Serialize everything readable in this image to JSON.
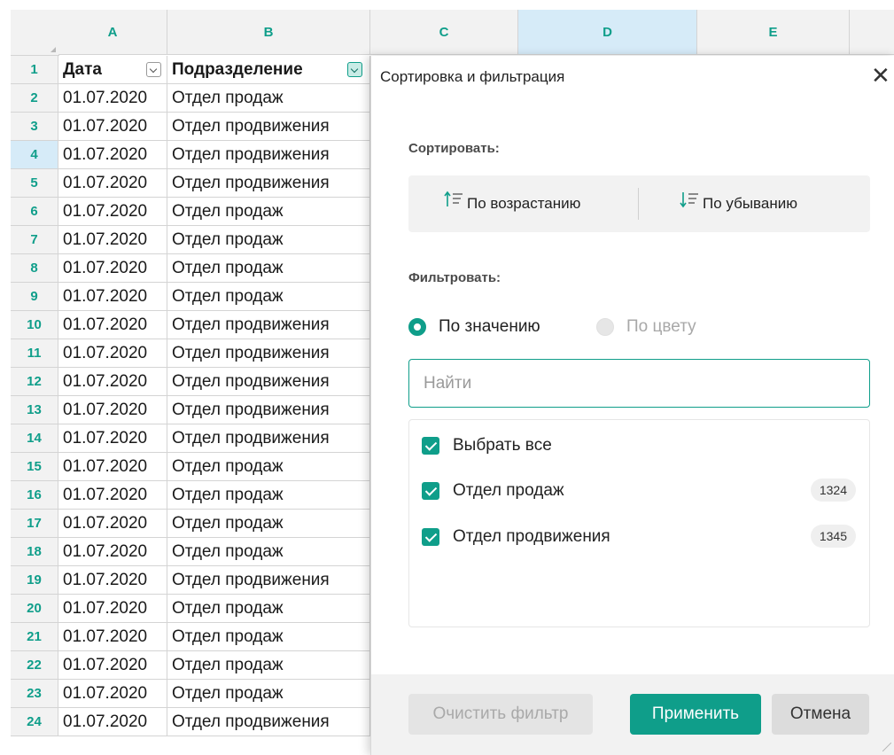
{
  "columns": [
    "A",
    "B",
    "C",
    "D",
    "E"
  ],
  "rows": [
    {
      "num": "1",
      "date": "Дата",
      "dept": "Подразделение"
    },
    {
      "num": "2",
      "date": "01.07.2020",
      "dept": "Отдел продаж"
    },
    {
      "num": "3",
      "date": "01.07.2020",
      "dept": "Отдел продвижения"
    },
    {
      "num": "4",
      "date": "01.07.2020",
      "dept": "Отдел продвижения"
    },
    {
      "num": "5",
      "date": "01.07.2020",
      "dept": "Отдел продвижения"
    },
    {
      "num": "6",
      "date": "01.07.2020",
      "dept": "Отдел продаж"
    },
    {
      "num": "7",
      "date": "01.07.2020",
      "dept": "Отдел продаж"
    },
    {
      "num": "8",
      "date": "01.07.2020",
      "dept": "Отдел продаж"
    },
    {
      "num": "9",
      "date": "01.07.2020",
      "dept": "Отдел продаж"
    },
    {
      "num": "10",
      "date": "01.07.2020",
      "dept": "Отдел продвижения"
    },
    {
      "num": "11",
      "date": "01.07.2020",
      "dept": "Отдел продвижения"
    },
    {
      "num": "12",
      "date": "01.07.2020",
      "dept": "Отдел продвижения"
    },
    {
      "num": "13",
      "date": "01.07.2020",
      "dept": "Отдел продвижения"
    },
    {
      "num": "14",
      "date": "01.07.2020",
      "dept": "Отдел продвижения"
    },
    {
      "num": "15",
      "date": "01.07.2020",
      "dept": "Отдел продаж"
    },
    {
      "num": "16",
      "date": "01.07.2020",
      "dept": "Отдел продаж"
    },
    {
      "num": "17",
      "date": "01.07.2020",
      "dept": "Отдел продаж"
    },
    {
      "num": "18",
      "date": "01.07.2020",
      "dept": "Отдел продаж"
    },
    {
      "num": "19",
      "date": "01.07.2020",
      "dept": "Отдел продвижения"
    },
    {
      "num": "20",
      "date": "01.07.2020",
      "dept": "Отдел продаж"
    },
    {
      "num": "21",
      "date": "01.07.2020",
      "dept": "Отдел продаж"
    },
    {
      "num": "22",
      "date": "01.07.2020",
      "dept": "Отдел продаж"
    },
    {
      "num": "23",
      "date": "01.07.2020",
      "dept": "Отдел продаж"
    },
    {
      "num": "24",
      "date": "01.07.2020",
      "dept": "Отдел продвижения"
    }
  ],
  "dialog": {
    "title": "Сортировка и фильтрация",
    "close_icon": "close-icon",
    "sort_label": "Сортировать:",
    "sort_asc": "По возрастанию",
    "sort_desc": "По убыванию",
    "filter_label": "Фильтровать:",
    "by_value": "По значению",
    "by_color": "По цвету",
    "search_placeholder": "Найти",
    "select_all": "Выбрать все",
    "items": [
      {
        "label": "Отдел продаж",
        "count": "1324"
      },
      {
        "label": "Отдел продвижения",
        "count": "1345"
      }
    ],
    "clear_filter": "Очистить фильтр",
    "apply": "Применить",
    "cancel": "Отмена"
  },
  "colors": {
    "accent": "#0f9e8a",
    "selected_header": "#d6ebf8"
  }
}
